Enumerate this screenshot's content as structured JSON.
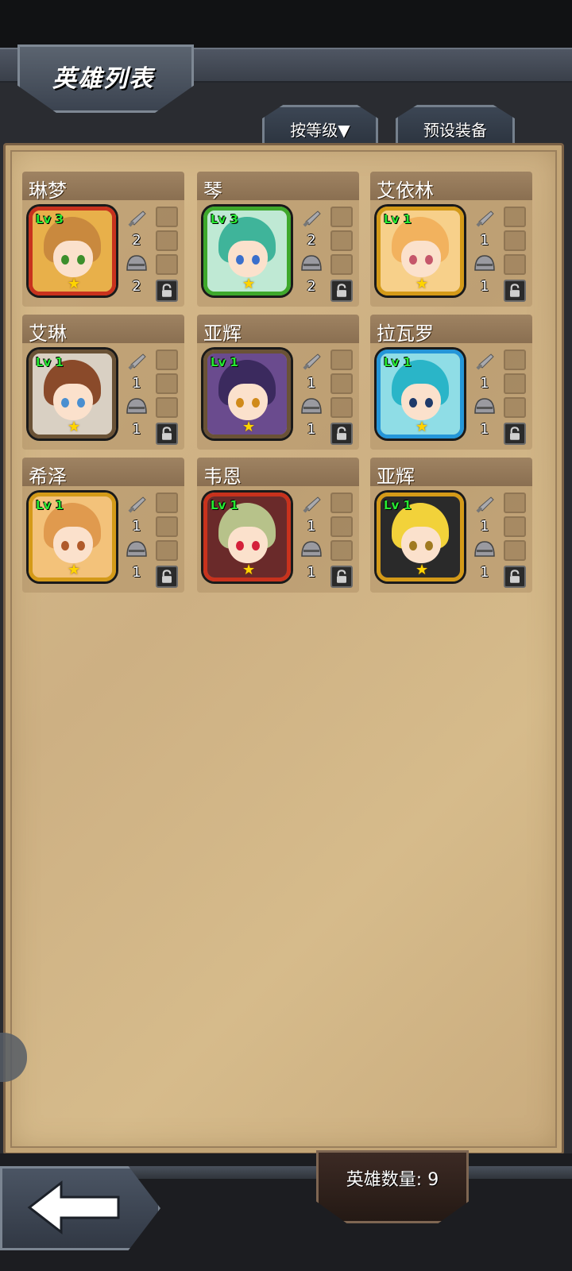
{
  "header": {
    "title": "英雄列表"
  },
  "tabs": {
    "sort_label": "按等级▼",
    "preset_label": "预设装备"
  },
  "heroes": [
    {
      "name": "琳梦",
      "level": "Lv 3",
      "frame": "red",
      "weapon": "2",
      "armor": "2",
      "hair": "#c9893e",
      "eye": "#3d8f2c",
      "bg": "#e8b04a"
    },
    {
      "name": "琴",
      "level": "Lv 3",
      "frame": "green",
      "weapon": "2",
      "armor": "2",
      "hair": "#3fb49a",
      "eye": "#3a6fcc",
      "bg": "#bfe9d4"
    },
    {
      "name": "艾依林",
      "level": "Lv 1",
      "frame": "gold",
      "weapon": "1",
      "armor": "1",
      "hair": "#f2b25e",
      "eye": "#c5566a",
      "bg": "#f7d08a"
    },
    {
      "name": "艾琳",
      "level": "Lv 1",
      "frame": "brown",
      "weapon": "1",
      "armor": "1",
      "hair": "#8a4a2a",
      "eye": "#4a8fd0",
      "bg": "#d9d0c3"
    },
    {
      "name": "亚辉",
      "level": "Lv 1",
      "frame": "brown",
      "weapon": "1",
      "armor": "1",
      "hair": "#3b2a5e",
      "eye": "#d08a1a",
      "bg": "#6a4b8e"
    },
    {
      "name": "拉瓦罗",
      "level": "Lv 1",
      "frame": "blue",
      "weapon": "1",
      "armor": "1",
      "hair": "#2ab5c8",
      "eye": "#1e3a6a",
      "bg": "#8fdde6"
    },
    {
      "name": "希泽",
      "level": "Lv 1",
      "frame": "gold",
      "weapon": "1",
      "armor": "1",
      "hair": "#e09a4e",
      "eye": "#b05a2a",
      "bg": "#f3c27a"
    },
    {
      "name": "韦恩",
      "level": "Lv 1",
      "frame": "red",
      "weapon": "1",
      "armor": "1",
      "hair": "#b7c28a",
      "eye": "#d4203a",
      "bg": "#6a2a2a"
    },
    {
      "name": "亚辉",
      "level": "Lv 1",
      "frame": "gold",
      "weapon": "1",
      "armor": "1",
      "hair": "#f2d23a",
      "eye": "#a07a20",
      "bg": "#2a2a2a"
    }
  ],
  "footer": {
    "hero_count": "英雄数量: 9"
  },
  "colors": {
    "panel": "#d3b787",
    "level_text": "#27e832",
    "star": "#ffd400"
  }
}
